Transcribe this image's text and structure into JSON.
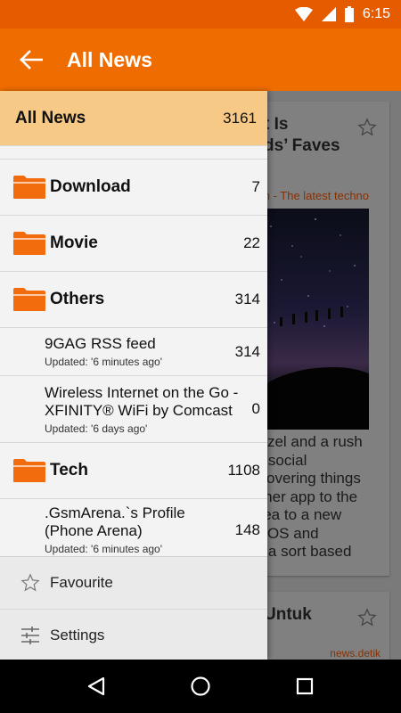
{
  "status_bar": {
    "time": "6:15"
  },
  "app_bar": {
    "title": "All News"
  },
  "drawer": {
    "header": {
      "label": "All News",
      "count": "3161"
    },
    "folders": [
      {
        "name": "Download",
        "count": "7"
      },
      {
        "name": "Movie",
        "count": "22"
      },
      {
        "name": "Others",
        "count": "314"
      },
      {
        "name": "Tech",
        "count": "1108"
      }
    ],
    "feeds": [
      {
        "name": "9GAG RSS feed",
        "updated": "Updated: '6 minutes ago'",
        "count": "314"
      },
      {
        "name": "Wireless Internet on the Go -\nXFINITY® WiFi by Comcast",
        "updated": "Updated: '6 days ago'",
        "count": "0"
      },
      {
        "name": ".GsmArena.`s Profile\n(Phone Arena)",
        "updated": "Updated: '6 minutes ago'",
        "count": "148"
      }
    ],
    "footer": {
      "favourite": "Favourite",
      "settings": "Settings"
    }
  },
  "background_cards": [
    {
      "title": "t Is\nds’ Faves",
      "source": "nch - The latest techno",
      "excerpt": "uzzel and a rush\nof social\nscovering things\nother app to the\nidea to a new\nn iOS and\nof a sort based"
    },
    {
      "title": "Untuk",
      "source": "news.detik"
    }
  ],
  "colors": {
    "status_bar": "#e55c00",
    "app_bar": "#ef6c00",
    "drawer_header": "#f7c987",
    "folder_icon": "#f26b0d"
  }
}
